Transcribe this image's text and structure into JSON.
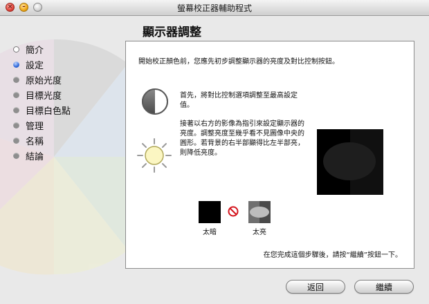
{
  "window": {
    "title": "螢幕校正器輔助程式",
    "close_glyph": "×",
    "minimize_glyph": "–"
  },
  "page": {
    "title": "顯示器調整"
  },
  "steps": [
    {
      "label": "簡介",
      "status": "done"
    },
    {
      "label": "設定",
      "status": "current"
    },
    {
      "label": "原始光度",
      "status": "pending"
    },
    {
      "label": "目標光度",
      "status": "pending"
    },
    {
      "label": "目標白色點",
      "status": "pending"
    },
    {
      "label": "管理",
      "status": "pending"
    },
    {
      "label": "名稱",
      "status": "pending"
    },
    {
      "label": "結論",
      "status": "pending"
    }
  ],
  "panel": {
    "intro": "開始校正顏色前，您應先初步調整顯示器的亮度及對比控制按鈕。",
    "contrast_text": "首先，將對比控制選項調整至最高設定值。",
    "brightness_text": "接著以右方的影像為指引來設定顯示器的亮度。調整亮度至幾乎看不見圖像中央的圓形。若背景的右半部顯得比左半部亮，則降低亮度。",
    "too_dark_label": "太暗",
    "too_bright_label": "太亮",
    "footer": "在您完成這個步驟後，請按“繼續”按鈕一下。"
  },
  "buttons": {
    "back": "返回",
    "continue": "繼續"
  },
  "colors": {
    "current_step": "#2a64d8",
    "window_bg": "#e9e9e9",
    "panel_bg": "#ffffff",
    "no_sign": "#d4141d"
  },
  "icons": {
    "contrast": "contrast-icon",
    "brightness": "sun-icon",
    "prohibited": "no-sign-icon"
  }
}
